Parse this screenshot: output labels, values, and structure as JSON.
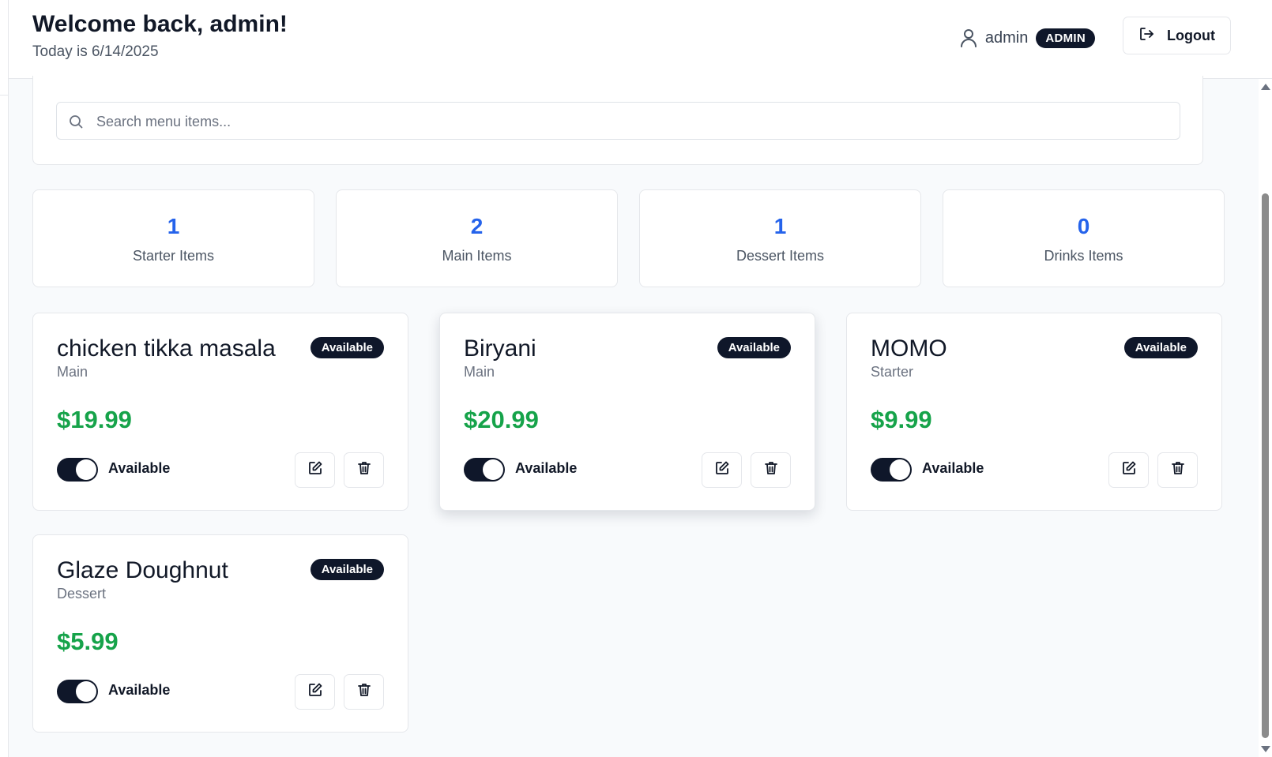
{
  "header": {
    "welcome": "Welcome back, admin!",
    "today": "Today is 6/14/2025",
    "user_name": "admin",
    "role_badge": "ADMIN",
    "logout_label": "Logout"
  },
  "search": {
    "placeholder": "Search menu items...",
    "value": ""
  },
  "stats": [
    {
      "count": "1",
      "label": "Starter Items"
    },
    {
      "count": "2",
      "label": "Main Items"
    },
    {
      "count": "1",
      "label": "Dessert Items"
    },
    {
      "count": "0",
      "label": "Drinks Items"
    }
  ],
  "menu_items": [
    {
      "name": "chicken tikka masala",
      "category": "Main",
      "price": "$19.99",
      "status": "Available",
      "toggle_label": "Available",
      "available": true
    },
    {
      "name": "Biryani",
      "category": "Main",
      "price": "$20.99",
      "status": "Available",
      "toggle_label": "Available",
      "available": true
    },
    {
      "name": "MOMO",
      "category": "Starter",
      "price": "$9.99",
      "status": "Available",
      "toggle_label": "Available",
      "available": true
    },
    {
      "name": "Glaze Doughnut",
      "category": "Dessert",
      "price": "$5.99",
      "status": "Available",
      "toggle_label": "Available",
      "available": true
    }
  ],
  "icons": {
    "user": "user-icon",
    "logout": "logout-icon",
    "search": "search-icon",
    "edit": "edit-icon",
    "delete": "trash-icon"
  },
  "colors": {
    "accent_dark": "#0f172a",
    "stat_blue": "#2563eb",
    "price_green": "#16a34a",
    "page_bg": "#f8fafc"
  }
}
